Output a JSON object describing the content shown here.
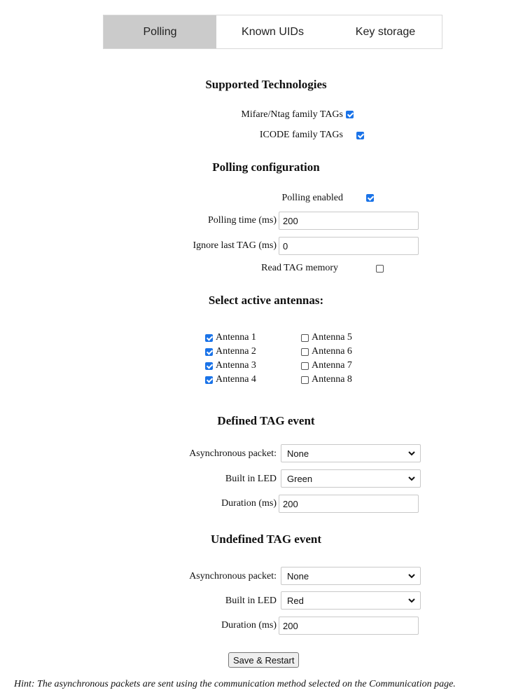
{
  "tabs": [
    "Polling",
    "Known UIDs",
    "Key storage"
  ],
  "supported": {
    "heading": "Supported Technologies",
    "mifare": {
      "label": "Mifare/Ntag family TAGs",
      "checked": true
    },
    "icode": {
      "label": "ICODE family TAGs",
      "checked": true
    }
  },
  "polling": {
    "heading": "Polling configuration",
    "enabled_label": "Polling enabled",
    "enabled": true,
    "time_label": "Polling time (ms)",
    "time_value": "200",
    "ignore_label": "Ignore last TAG (ms)",
    "ignore_value": "0",
    "read_label": "Read TAG memory",
    "read": false
  },
  "antennas": {
    "heading": "Select active antennas:",
    "items": [
      {
        "label": "Antenna 1",
        "checked": true
      },
      {
        "label": "Antenna 2",
        "checked": true
      },
      {
        "label": "Antenna 3",
        "checked": true
      },
      {
        "label": "Antenna 4",
        "checked": true
      },
      {
        "label": "Antenna 5",
        "checked": false
      },
      {
        "label": "Antenna 6",
        "checked": false
      },
      {
        "label": "Antenna 7",
        "checked": false
      },
      {
        "label": "Antenna 8",
        "checked": false
      }
    ]
  },
  "defined": {
    "heading": "Defined TAG event",
    "async_label": "Asynchronous packet:",
    "async_value": "None",
    "led_label": "Built in LED",
    "led_value": "Green",
    "duration_label": "Duration (ms)",
    "duration_value": "200"
  },
  "undefined": {
    "heading": "Undefined TAG event",
    "async_label": "Asynchronous packet:",
    "async_value": "None",
    "led_label": "Built in LED",
    "led_value": "Red",
    "duration_label": "Duration (ms)",
    "duration_value": "200"
  },
  "save_label": "Save & Restart",
  "hint": "Hint: The asynchronous packets are sent using the communication method selected on the Communication page."
}
